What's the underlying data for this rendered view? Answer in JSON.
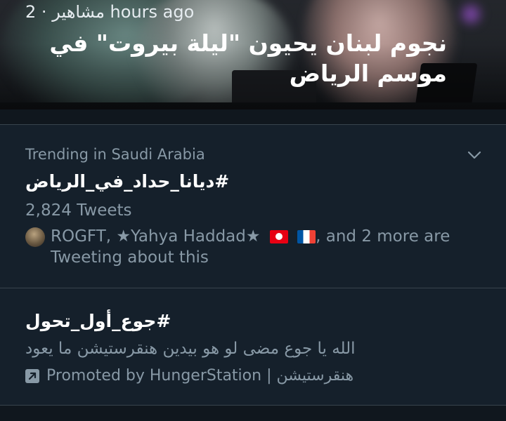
{
  "moment": {
    "category": "مشاهير",
    "time_ago": "2 hours ago",
    "title": "نجوم لبنان يحيون \"ليلة بيروت\" في موسم الرياض"
  },
  "trend": {
    "context": "Trending in Saudi Arabia",
    "hashtag": "#ديانا_حداد_في_الرياض",
    "tweet_count": "2,824 Tweets",
    "social": {
      "users": "ROGFT, ★Yahya Haddad★",
      "flags": [
        "tunisia-flag",
        "france-flag"
      ],
      "rest": ", and 2 more are Tweeting about this"
    }
  },
  "promoted": {
    "hashtag": "#جوع_أول_تحول",
    "description": "الله يا جوع مضى لو هو بيدين هنقرستيشن ما يعود",
    "promoted_by": "Promoted by HungerStation",
    "separator": "|",
    "brand_ar": "هنقرستيشن"
  },
  "colors": {
    "background": "#15202b",
    "secondary_text": "#8899a6",
    "divider": "#38444d"
  }
}
